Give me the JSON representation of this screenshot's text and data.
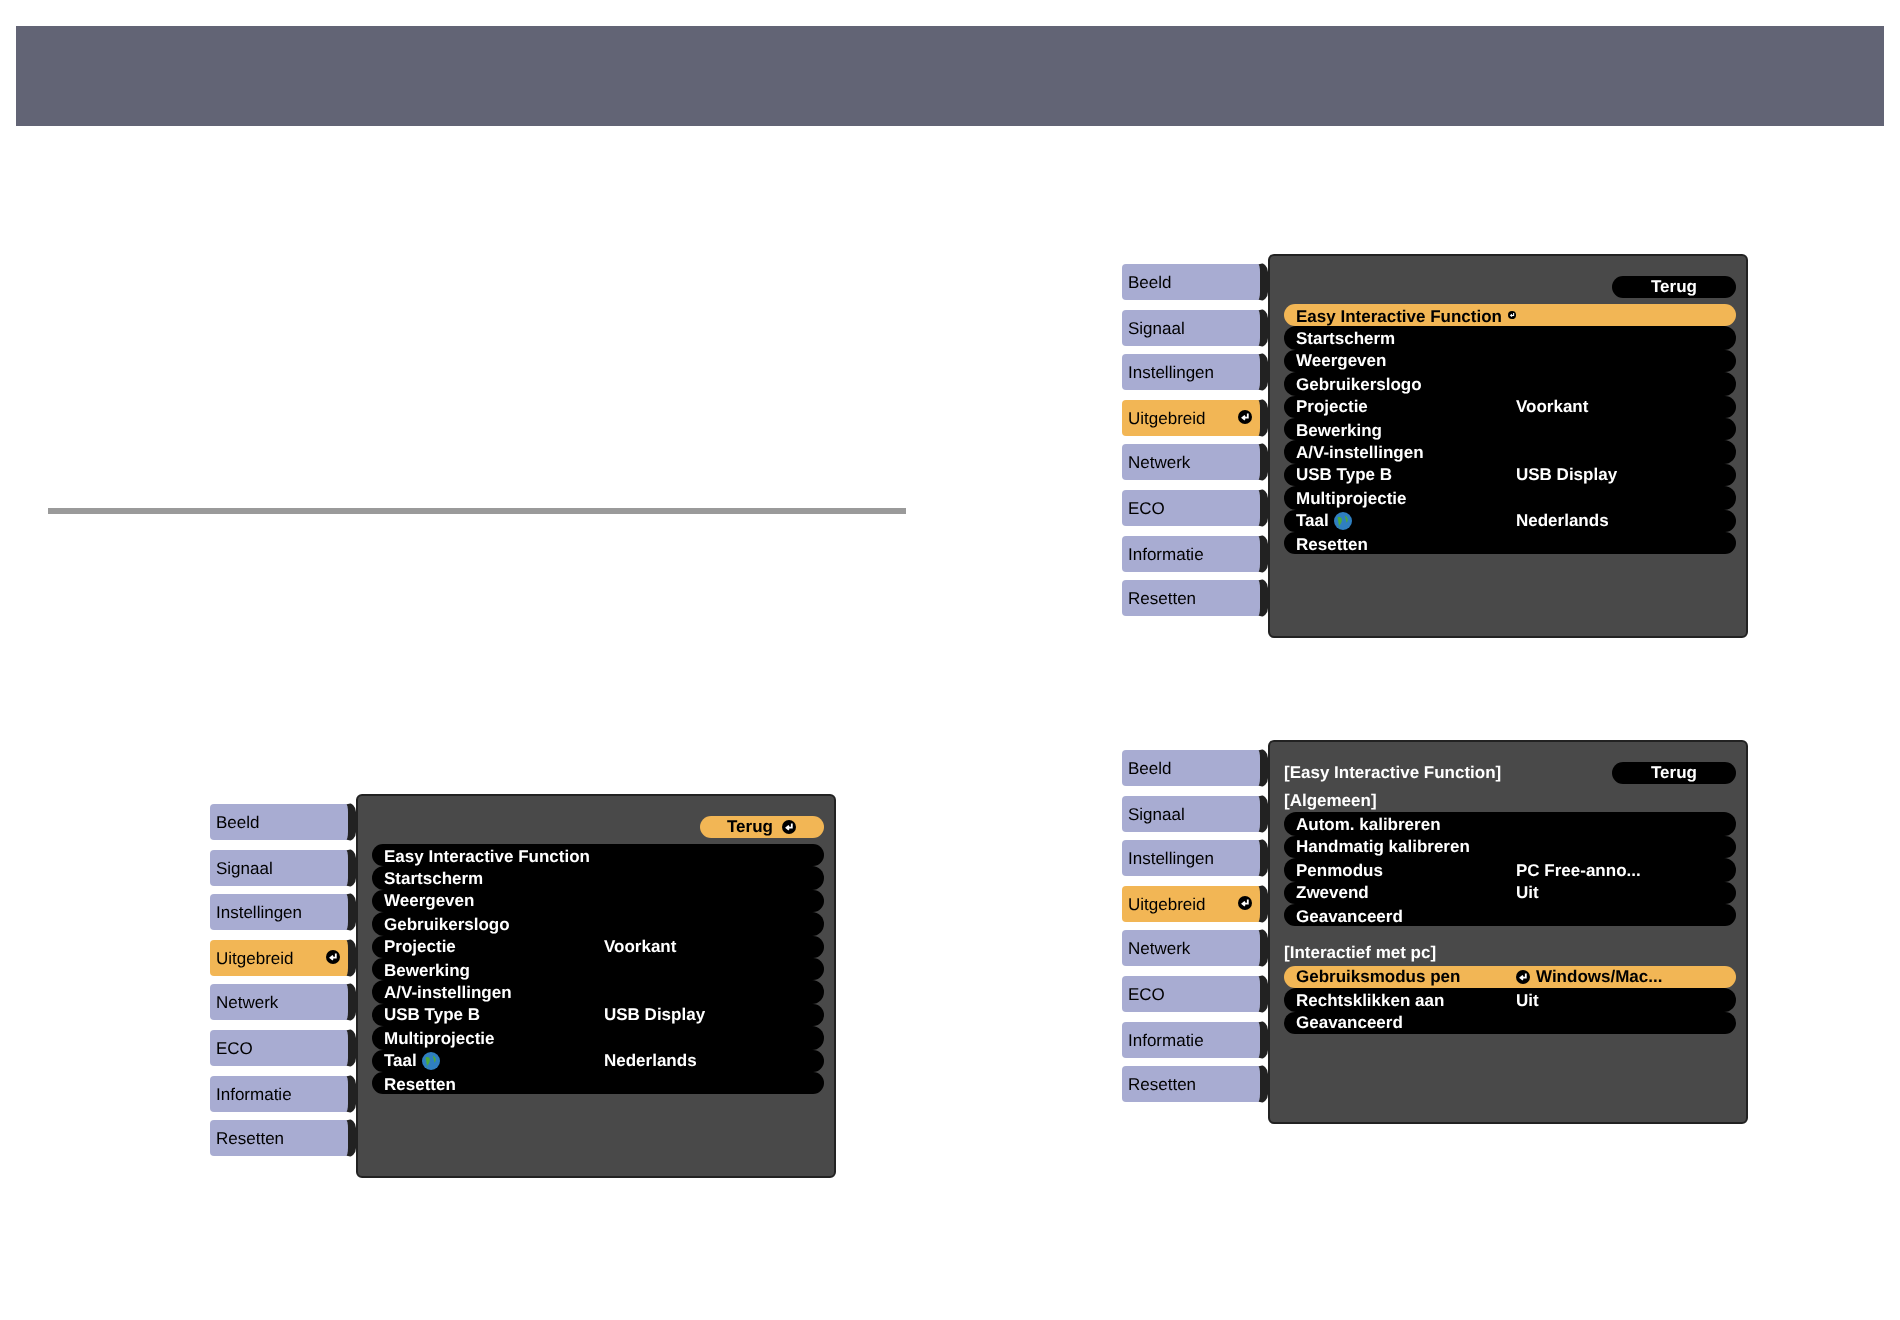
{
  "menus": [
    {
      "tabs": [
        {
          "label": "Beeld",
          "selected": false
        },
        {
          "label": "Signaal",
          "selected": false
        },
        {
          "label": "Instellingen",
          "selected": false
        },
        {
          "label": "Uitgebreid",
          "selected": true
        },
        {
          "label": "Netwerk",
          "selected": false
        },
        {
          "label": "ECO",
          "selected": false
        },
        {
          "label": "Informatie",
          "selected": false
        },
        {
          "label": "Resetten",
          "selected": false
        }
      ],
      "back": {
        "label": "Terug",
        "selected": true
      },
      "rows": [
        {
          "kind": "item",
          "label": "Easy Interactive Function",
          "selected": false
        },
        {
          "kind": "item",
          "label": "Startscherm",
          "selected": false
        },
        {
          "kind": "item",
          "label": "Weergeven",
          "selected": false
        },
        {
          "kind": "item",
          "label": "Gebruikerslogo",
          "selected": false
        },
        {
          "kind": "item",
          "label": "Projectie",
          "value": "Voorkant",
          "selected": false
        },
        {
          "kind": "item",
          "label": "Bewerking",
          "selected": false
        },
        {
          "kind": "item",
          "label": "A/V-instellingen",
          "selected": false
        },
        {
          "kind": "item",
          "label": "USB Type B",
          "value": "USB Display",
          "selected": false
        },
        {
          "kind": "item",
          "label": "Multiprojectie",
          "selected": false
        },
        {
          "kind": "item",
          "label": "Taal",
          "globe": true,
          "value": "Nederlands",
          "selected": false
        },
        {
          "kind": "item",
          "label": "Resetten",
          "selected": false
        }
      ]
    },
    {
      "tabs": [
        {
          "label": "Beeld",
          "selected": false
        },
        {
          "label": "Signaal",
          "selected": false
        },
        {
          "label": "Instellingen",
          "selected": false
        },
        {
          "label": "Uitgebreid",
          "selected": true
        },
        {
          "label": "Netwerk",
          "selected": false
        },
        {
          "label": "ECO",
          "selected": false
        },
        {
          "label": "Informatie",
          "selected": false
        },
        {
          "label": "Resetten",
          "selected": false
        }
      ],
      "back": {
        "label": "Terug",
        "selected": false
      },
      "rows": [
        {
          "kind": "item",
          "label": "Easy Interactive Function",
          "selected": true
        },
        {
          "kind": "item",
          "label": "Startscherm",
          "selected": false
        },
        {
          "kind": "item",
          "label": "Weergeven",
          "selected": false
        },
        {
          "kind": "item",
          "label": "Gebruikerslogo",
          "selected": false
        },
        {
          "kind": "item",
          "label": "Projectie",
          "value": "Voorkant",
          "selected": false
        },
        {
          "kind": "item",
          "label": "Bewerking",
          "selected": false
        },
        {
          "kind": "item",
          "label": "A/V-instellingen",
          "selected": false
        },
        {
          "kind": "item",
          "label": "USB Type B",
          "value": "USB Display",
          "selected": false
        },
        {
          "kind": "item",
          "label": "Multiprojectie",
          "selected": false
        },
        {
          "kind": "item",
          "label": "Taal",
          "globe": true,
          "value": "Nederlands",
          "selected": false
        },
        {
          "kind": "item",
          "label": "Resetten",
          "selected": false
        }
      ]
    },
    {
      "tabs": [
        {
          "label": "Beeld",
          "selected": false
        },
        {
          "label": "Signaal",
          "selected": false
        },
        {
          "label": "Instellingen",
          "selected": false
        },
        {
          "label": "Uitgebreid",
          "selected": true
        },
        {
          "label": "Netwerk",
          "selected": false
        },
        {
          "label": "ECO",
          "selected": false
        },
        {
          "label": "Informatie",
          "selected": false
        },
        {
          "label": "Resetten",
          "selected": false
        }
      ],
      "title": "[Easy Interactive Function]",
      "back": {
        "label": "Terug",
        "selected": false
      },
      "rows": [
        {
          "kind": "heading",
          "label": "[Algemeen]"
        },
        {
          "kind": "item",
          "label": "Autom. kalibreren",
          "selected": false
        },
        {
          "kind": "item",
          "label": "Handmatig kalibreren",
          "selected": false
        },
        {
          "kind": "item",
          "label": "Penmodus",
          "value": "PC Free-anno...",
          "selected": false
        },
        {
          "kind": "item",
          "label": "Zwevend",
          "value": "Uit",
          "selected": false
        },
        {
          "kind": "item",
          "label": "Geavanceerd",
          "selected": false
        },
        {
          "kind": "gap"
        },
        {
          "kind": "heading",
          "label": "[Interactief met pc]"
        },
        {
          "kind": "item",
          "label": "Gebruiksmodus pen",
          "value": "Windows/Mac...",
          "selected": true
        },
        {
          "kind": "item",
          "label": "Rechtsklikken aan",
          "value": "Uit",
          "selected": false
        },
        {
          "kind": "item",
          "label": "Geavanceerd",
          "selected": false
        }
      ]
    }
  ]
}
